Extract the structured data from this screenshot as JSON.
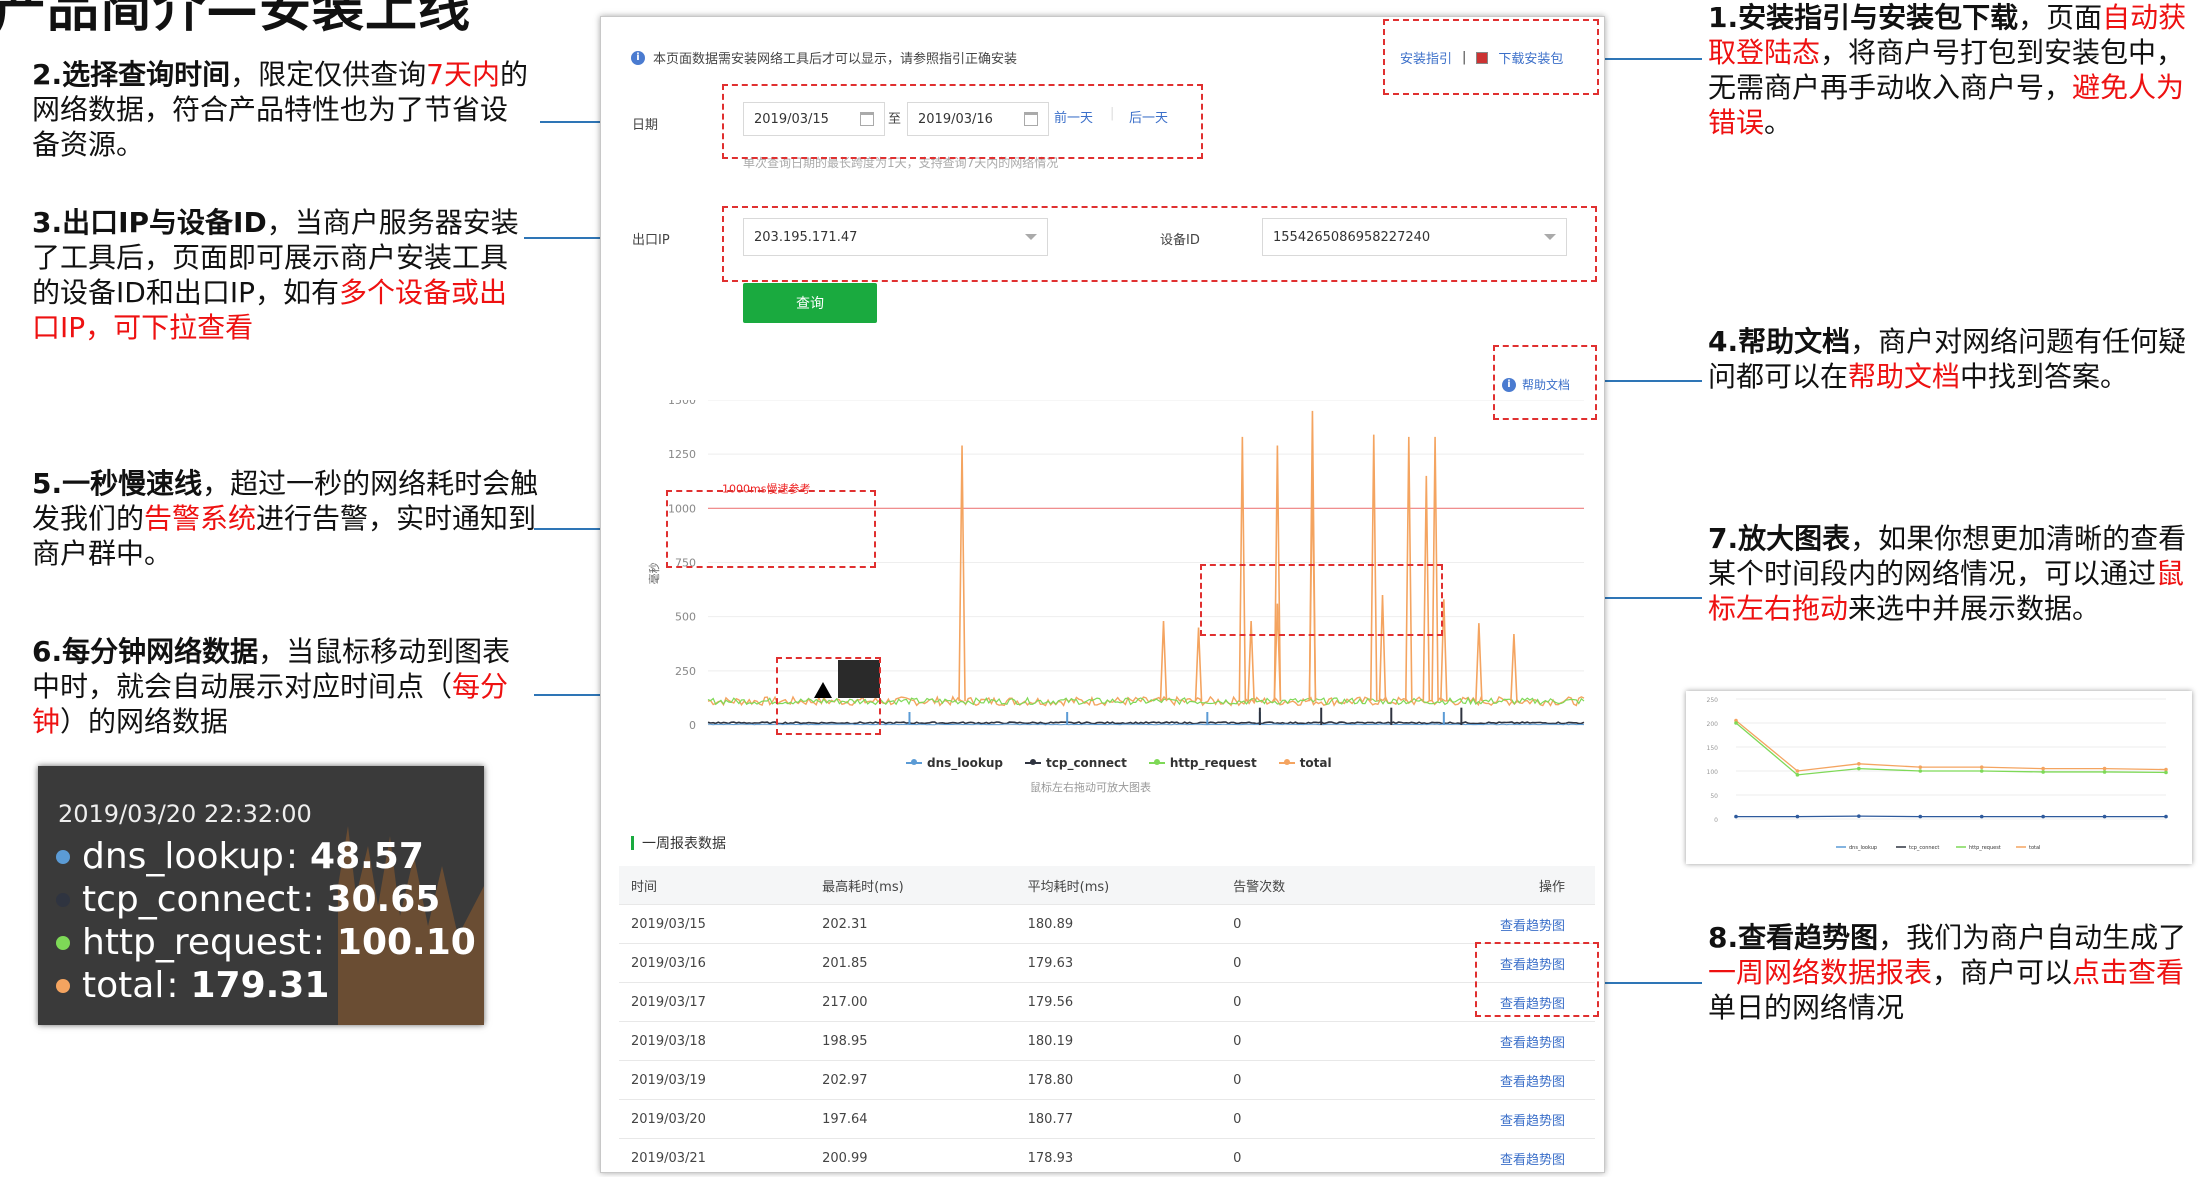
{
  "slide": {
    "title": "产品简介—安装上线"
  },
  "annotations": {
    "a1": {
      "num_title": "1.安装指引与安装包下载",
      "t1": "，页面",
      "t2": "自动获取登陆态",
      "t3": "，将商户号打包到安装包中，无需商户再手动收入商户号，",
      "t4": "避免人为错误",
      "t5": "。"
    },
    "a2": {
      "num_title": "2.选择查询时间",
      "t1": "，限定仅供查询",
      "t2": "7天内",
      "t3": "的网络数据，符合产品特性也为了节省设备资源。"
    },
    "a3": {
      "num_title": "3.出口IP与设备ID",
      "t1": "，当商户服务器安装了工具后，页面即可展示商户安装工具的设备ID和出口IP，如有",
      "t2": "多个设备或出口IP，可下拉查看"
    },
    "a4": {
      "num_title": "4.帮助文档",
      "t1": "，商户对网络问题有任何疑问都可以在",
      "t2": "帮助文档",
      "t3": "中找到答案。"
    },
    "a5": {
      "num_title": "5.一秒慢速线",
      "t1": "，超过一秒的网络耗时会触发我们的",
      "t2": "告警系统",
      "t3": "进行告警，实时通知到商户群中。"
    },
    "a6": {
      "num_title": "6.每分钟网络数据",
      "t1": "，当鼠标移动到图表中时，就会自动展示对应时间点（",
      "t2": "每分钟",
      "t3": "）的网络数据"
    },
    "a7": {
      "num_title": "7.放大图表",
      "t1": "，如果你想更加清晰的查看某个时间段内的网络情况，可以通过",
      "t2": "鼠标左右拖动",
      "t3": "来选中并展示数据。"
    },
    "a8": {
      "num_title": "8.查看趋势图",
      "t1": "，我们为商户自动生成了",
      "t2": "一周网络数据报表",
      "t3": "，商户可以",
      "t4": "点击查看",
      "t5": "单日的网络情况"
    }
  },
  "page": {
    "notice": "本页面数据需安装网络工具后才可以显示，请参照指引正确安装",
    "install_guide": "安装指引",
    "separator": "|",
    "download": "下载安装包",
    "date_label": "日期",
    "date_start": "2019/03/15",
    "date_to": "至",
    "date_end": "2019/03/16",
    "prev_day": "前一天",
    "next_day": "后一天",
    "date_hint": "单次查询日期的最长跨度为1天，支持查询7天内的网络情况",
    "ip_label": "出口IP",
    "ip_value": "203.195.171.47",
    "device_label": "设备ID",
    "device_value": "1554265086958227240",
    "query_btn": "查询",
    "help_doc": "帮助文档",
    "chart_hint": "鼠标左右拖动可放大图表",
    "section_title": "一周报表数据"
  },
  "colors": {
    "dns_lookup": "#5b9bd5",
    "tcp_connect": "#2f3440",
    "http_request": "#7ed957",
    "total": "#f4a460",
    "accent": "#1aaa3f",
    "annotation_red": "#ee1111",
    "leader": "#2e75b6"
  },
  "chart_data": {
    "type": "line",
    "ylabel": "毫秒",
    "ylim": [
      0,
      1500
    ],
    "yticks": [
      0,
      250,
      500,
      750,
      1000,
      1250,
      1500
    ],
    "threshold": {
      "value": 1000,
      "label": "1000ms慢速参考"
    },
    "series": [
      {
        "name": "dns_lookup",
        "baseline": 3
      },
      {
        "name": "tcp_connect",
        "baseline": 10
      },
      {
        "name": "http_request",
        "baseline": 110
      },
      {
        "name": "total",
        "baseline": 110,
        "spikes": [
          [
            0.29,
            1290
          ],
          [
            0.61,
            1330
          ],
          [
            0.65,
            1290
          ],
          [
            0.69,
            1160
          ],
          [
            0.69,
            1450
          ],
          [
            0.65,
            560
          ],
          [
            0.52,
            480
          ],
          [
            0.56,
            450
          ],
          [
            0.62,
            480
          ],
          [
            0.76,
            1340
          ],
          [
            0.77,
            600
          ],
          [
            0.8,
            1330
          ],
          [
            0.82,
            1150
          ],
          [
            0.83,
            1330
          ],
          [
            0.84,
            580
          ],
          [
            0.88,
            470
          ],
          [
            0.92,
            420
          ]
        ]
      }
    ],
    "legend": [
      "dns_lookup",
      "tcp_connect",
      "http_request",
      "total"
    ]
  },
  "table": {
    "headers": [
      "时间",
      "最高耗时(ms)",
      "平均耗时(ms)",
      "告警次数",
      "操作"
    ],
    "rows": [
      [
        "2019/03/15",
        "202.31",
        "180.89",
        "0",
        "查看趋势图"
      ],
      [
        "2019/03/16",
        "201.85",
        "179.63",
        "0",
        "查看趋势图"
      ],
      [
        "2019/03/17",
        "217.00",
        "179.56",
        "0",
        "查看趋势图"
      ],
      [
        "2019/03/18",
        "198.95",
        "180.19",
        "0",
        "查看趋势图"
      ],
      [
        "2019/03/19",
        "202.97",
        "178.80",
        "0",
        "查看趋势图"
      ],
      [
        "2019/03/20",
        "197.64",
        "180.77",
        "0",
        "查看趋势图"
      ],
      [
        "2019/03/21",
        "200.99",
        "178.93",
        "0",
        "查看趋势图"
      ]
    ]
  },
  "tooltip_zoom": {
    "time": "2019/03/20 22:32:00",
    "rows": [
      {
        "name": "dns_lookup",
        "value": "48.57",
        "color": "#5b9bd5"
      },
      {
        "name": "tcp_connect",
        "value": "30.65",
        "color": "#2f3440"
      },
      {
        "name": "http_request",
        "value": "100.10",
        "color": "#7ed957"
      },
      {
        "name": "total",
        "value": "179.31",
        "color": "#f4a460"
      }
    ]
  },
  "thumb_chart": {
    "ylim": [
      0,
      250
    ],
    "yticks": [
      0,
      50,
      100,
      150,
      200,
      250
    ],
    "total": [
      205,
      100,
      115,
      108,
      108,
      105,
      105,
      103
    ],
    "http_request": [
      200,
      92,
      105,
      100,
      100,
      98,
      98,
      97
    ],
    "dns_lookup": [
      5,
      5,
      6,
      5,
      5,
      5,
      5,
      5
    ],
    "legend": [
      "dns_lookup",
      "tcp_connect",
      "http_request",
      "total"
    ]
  }
}
